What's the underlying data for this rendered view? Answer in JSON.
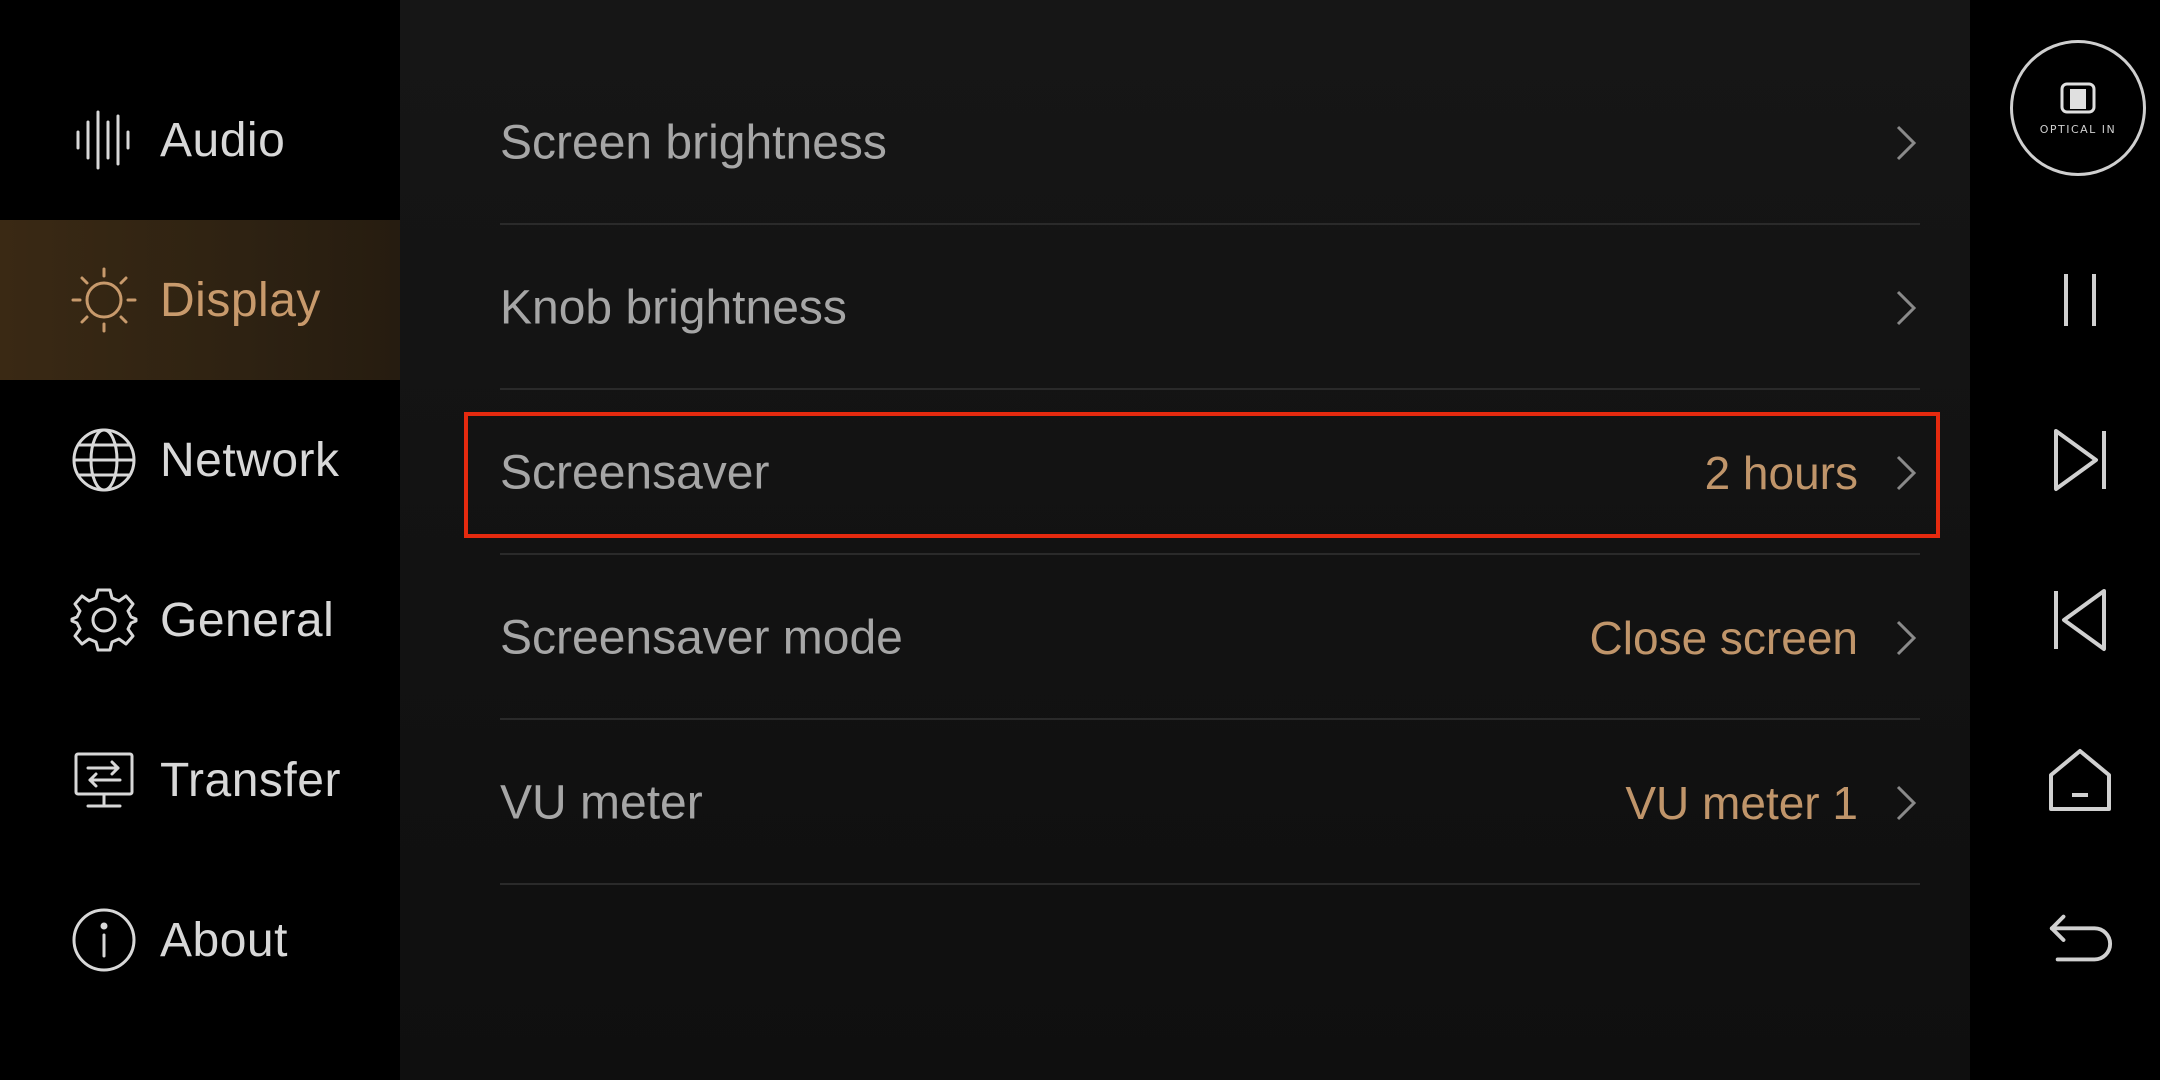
{
  "sidebar": {
    "items": [
      {
        "label": "Audio",
        "icon": "waveform-icon",
        "active": false
      },
      {
        "label": "Display",
        "icon": "sun-icon",
        "active": true
      },
      {
        "label": "Network",
        "icon": "globe-icon",
        "active": false
      },
      {
        "label": "General",
        "icon": "gear-icon",
        "active": false
      },
      {
        "label": "Transfer",
        "icon": "transfer-monitor-icon",
        "active": false
      },
      {
        "label": "About",
        "icon": "info-icon",
        "active": false
      }
    ]
  },
  "settings": {
    "rows": [
      {
        "label": "Screen brightness",
        "value": ""
      },
      {
        "label": "Knob brightness",
        "value": ""
      },
      {
        "label": "Screensaver",
        "value": "2 hours"
      },
      {
        "label": "Screensaver mode",
        "value": "Close screen"
      },
      {
        "label": "VU meter",
        "value": "VU meter 1"
      }
    ]
  },
  "player": {
    "source_label": "OPTICAL IN",
    "controls": [
      "pause-icon",
      "next-track-icon",
      "previous-track-icon",
      "home-icon",
      "back-icon"
    ]
  },
  "colors": {
    "accent": "#c0956a",
    "highlight_border": "#e52a0f",
    "active_bg": "#3a2914"
  }
}
